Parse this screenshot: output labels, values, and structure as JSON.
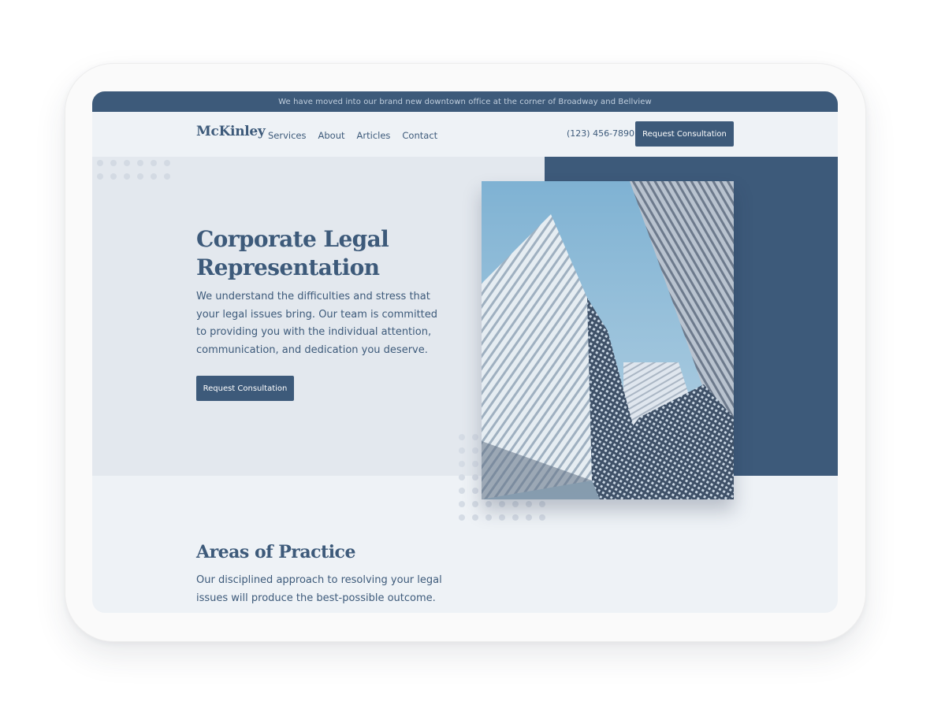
{
  "announcement": "We have moved into our brand new downtown office at the corner of Broadway and Bellview",
  "brand": {
    "logo": "McKinley"
  },
  "nav": {
    "items": [
      "Services",
      "About",
      "Articles",
      "Contact"
    ],
    "phone": "(123) 456-7890",
    "cta": "Request Consultation"
  },
  "hero": {
    "title": "Corporate Legal Representation",
    "text": "We understand the difficulties and stress that your legal issues bring. Our team is committed to providing you with the individual attention, communication, and dedication you deserve.",
    "cta": "Request Consultation",
    "image": "modern-glass-skyscrapers-photo"
  },
  "practice": {
    "title": "Areas of Practice",
    "text": "Our disciplined approach to resolving your legal issues will produce the best-possible outcome."
  },
  "colors": {
    "primary": "#3d5a7a",
    "hero_bg": "#e3e8ee",
    "page_bg": "#eef2f6"
  }
}
